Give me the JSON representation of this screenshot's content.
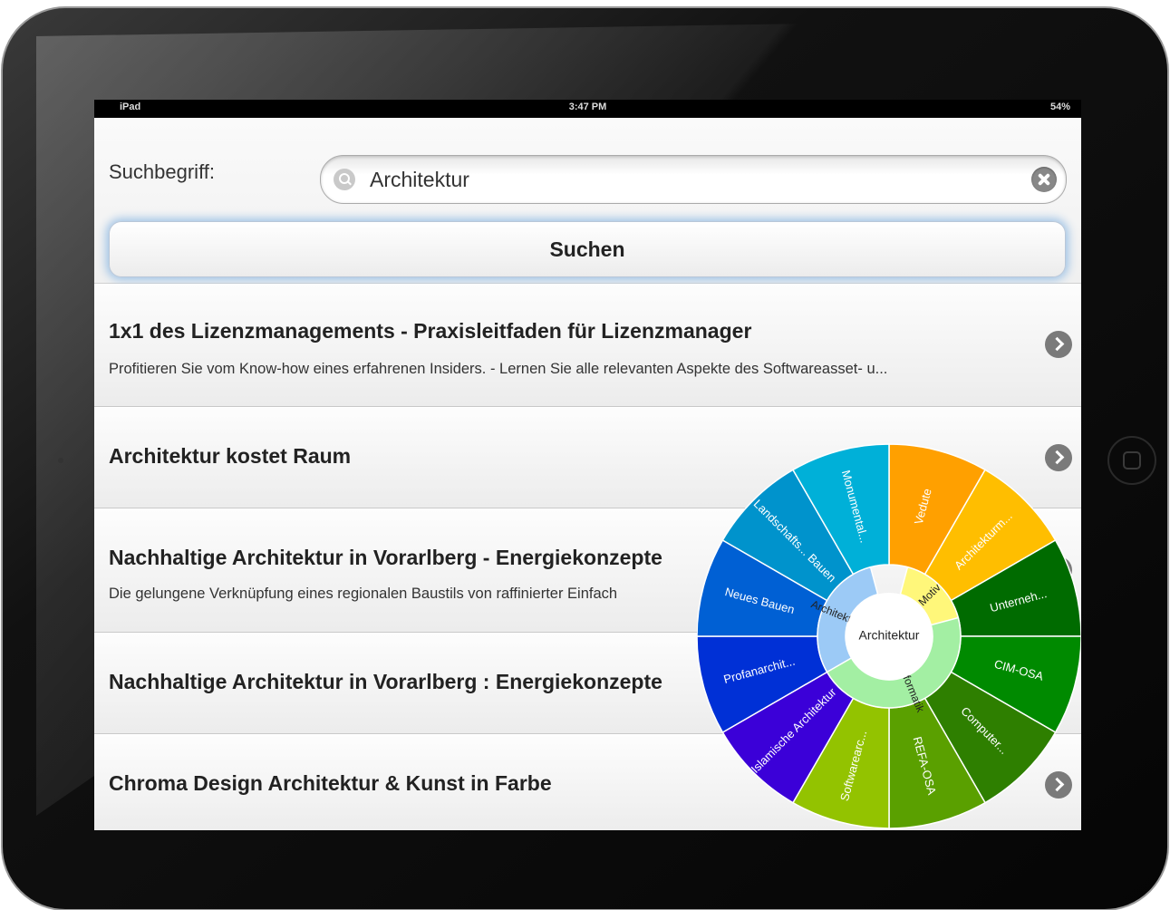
{
  "status": {
    "carrier": "iPad",
    "time": "3:47 PM",
    "battery": "54%"
  },
  "search": {
    "label": "Suchbegriff:",
    "value": "Architektur",
    "button": "Suchen"
  },
  "results": [
    {
      "title": "1x1 des Lizenzmanagements - Praxisleitfaden für Lizenzmanager",
      "desc": "Profitieren Sie vom Know-how eines erfahrenen Insiders. - Lernen Sie alle relevanten Aspekte des Softwareasset- u..."
    },
    {
      "title": "Architektur kostet Raum",
      "desc": ""
    },
    {
      "title": "Nachhaltige Architektur in Vorarlberg - Energiekonzepte",
      "desc": "Die gelungene Verknüpfung eines regionalen Baustils von raffinierter Einfach"
    },
    {
      "title": "Nachhaltige Architektur in Vorarlberg : Energiekonzepte",
      "desc": ""
    },
    {
      "title": "Chroma Design Architektur & Kunst in Farbe",
      "desc": ""
    }
  ],
  "wheel": {
    "center": "Architektur",
    "inner": [
      {
        "label": "Architektur",
        "color": "#9ccaf6"
      },
      {
        "label": "Motiv",
        "color": "#fff77a"
      },
      {
        "label": "Informatik",
        "color": "#a3efa3"
      }
    ],
    "outer": [
      {
        "label": "Vedute",
        "color": "#ffa000"
      },
      {
        "label": "Architekturm...",
        "color": "#ffbe00"
      },
      {
        "label": "Unterneh...",
        "color": "#006b00"
      },
      {
        "label": "CIM-OSA",
        "color": "#008a00"
      },
      {
        "label": "Computer...",
        "color": "#2e7f00"
      },
      {
        "label": "REFA-OSA",
        "color": "#5aa000"
      },
      {
        "label": "Softwarearc...",
        "color": "#93c300"
      },
      {
        "label": "Islamische Architektur",
        "color": "#3b00d8"
      },
      {
        "label": "Profanarchit...",
        "color": "#0030d6"
      },
      {
        "label": "Neues Bauen",
        "color": "#0060d4"
      },
      {
        "label": "Landschafts... Bauen",
        "color": "#0093cc"
      },
      {
        "label": "Monumental...",
        "color": "#00b0d8"
      }
    ]
  }
}
